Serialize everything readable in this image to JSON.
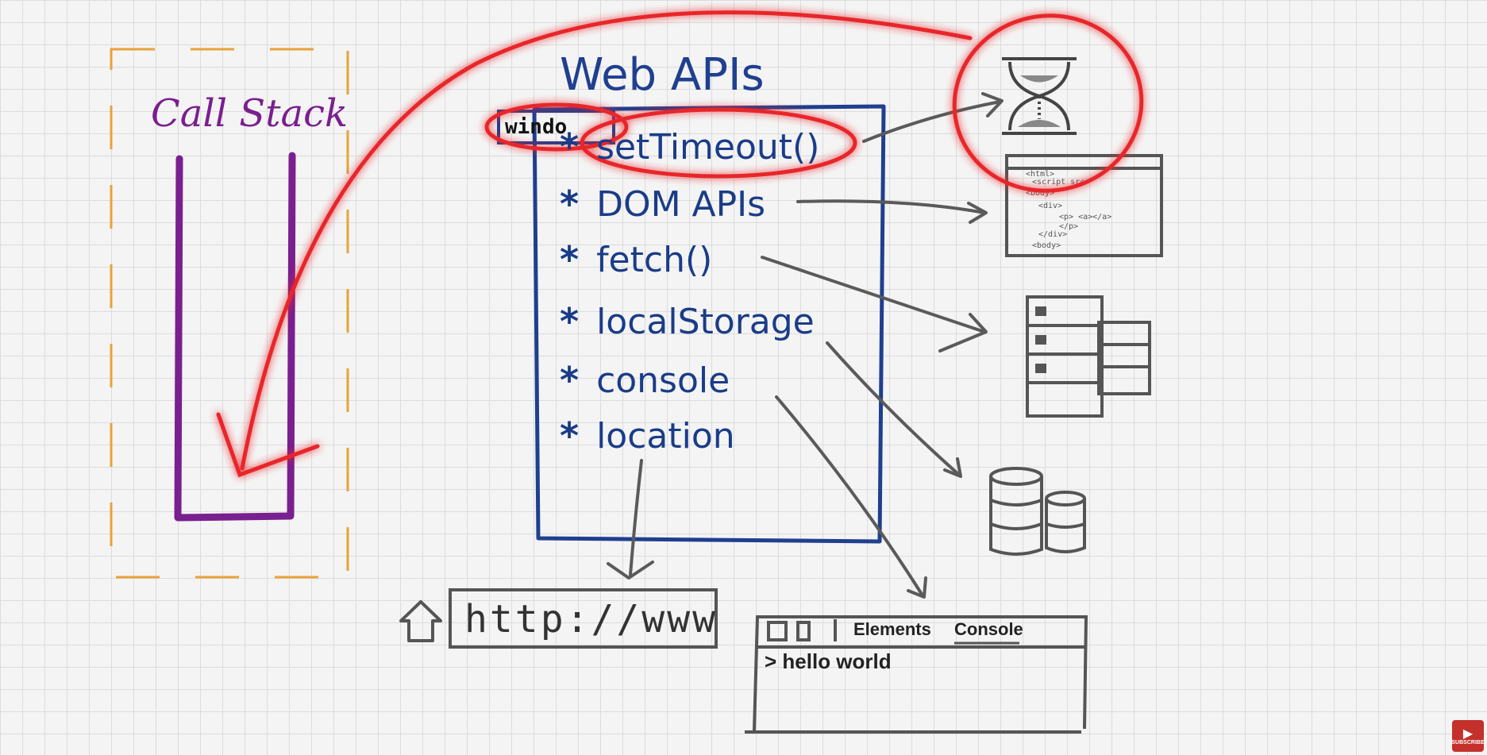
{
  "diagram": {
    "call_stack_title": "Call Stack",
    "web_apis_title": "Web APIs",
    "window_label": "windo",
    "api_list": [
      {
        "bullet": "*",
        "label": "setTimeout()"
      },
      {
        "bullet": "*",
        "label": "DOM APIs"
      },
      {
        "bullet": "*",
        "label": "fetch()"
      },
      {
        "bullet": "*",
        "label": "localStorage"
      },
      {
        "bullet": "*",
        "label": "console"
      },
      {
        "bullet": "*",
        "label": "location"
      }
    ],
    "url_bar_text": "http://www",
    "devtools": {
      "tab_elements": "Elements",
      "tab_console": "Console",
      "console_output": "> hello world"
    },
    "html_code_lines": [
      "<html>",
      "<script src",
      "<body>",
      "<div>",
      "<p> <a></a>",
      "</p>",
      "</div>",
      "<body>"
    ]
  },
  "colors": {
    "call_stack": "#7a1f8f",
    "web_apis": "#1f3f8f",
    "highlight": "#e8282b",
    "sketch": "#555555",
    "dashed_border": "#e8a23a"
  },
  "youtube": {
    "subscribe_label": "SUBSCRIBE"
  }
}
